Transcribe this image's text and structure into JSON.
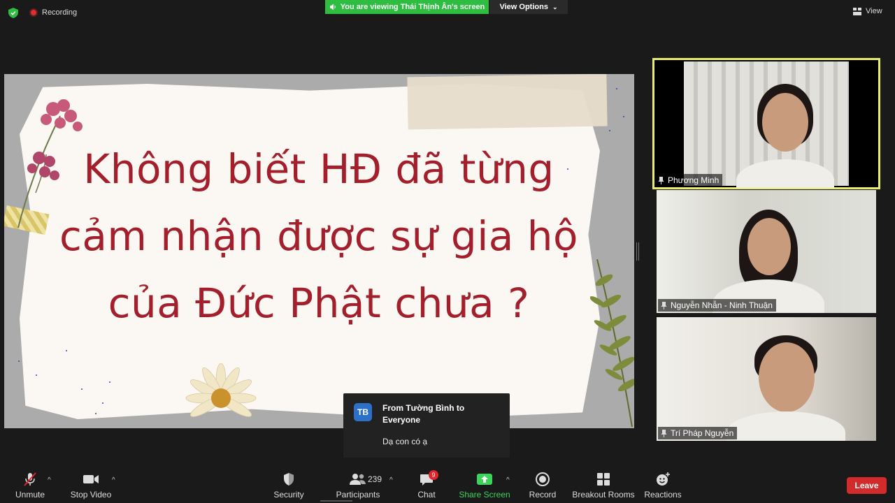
{
  "topbar": {
    "recording_label": "Recording",
    "viewing_banner": "You are viewing Thái Thịnh Ân's screen",
    "view_options_label": "View Options",
    "view_label": "View"
  },
  "slide": {
    "line1": "Không biết HĐ đã từng",
    "line2": "cảm nhận được sự gia hộ",
    "line3": "của Đức Phật  chưa ?"
  },
  "participants_tiles": [
    {
      "name": "Phương Minh",
      "active": true
    },
    {
      "name": "Nguyễn Nhẫn - Ninh Thuận",
      "active": false
    },
    {
      "name": "Trí Pháp Nguyễn",
      "active": false
    }
  ],
  "chat_toast": {
    "avatar_initials": "TB",
    "from": "From Tường Bình to Everyone",
    "message": "Dạ con có ạ"
  },
  "toolbar": {
    "unmute": "Unmute",
    "stop_video": "Stop Video",
    "security": "Security",
    "participants": "Participants",
    "participants_count": "239",
    "chat": "Chat",
    "chat_badge": "9",
    "share_screen": "Share Screen",
    "record": "Record",
    "breakout_rooms": "Breakout Rooms",
    "reactions": "Reactions",
    "leave": "Leave"
  },
  "colors": {
    "share_banner": "#2ebd40",
    "leave": "#d12b2b",
    "active_speaker": "#e9eb6a",
    "slide_text": "#a31f2c"
  }
}
